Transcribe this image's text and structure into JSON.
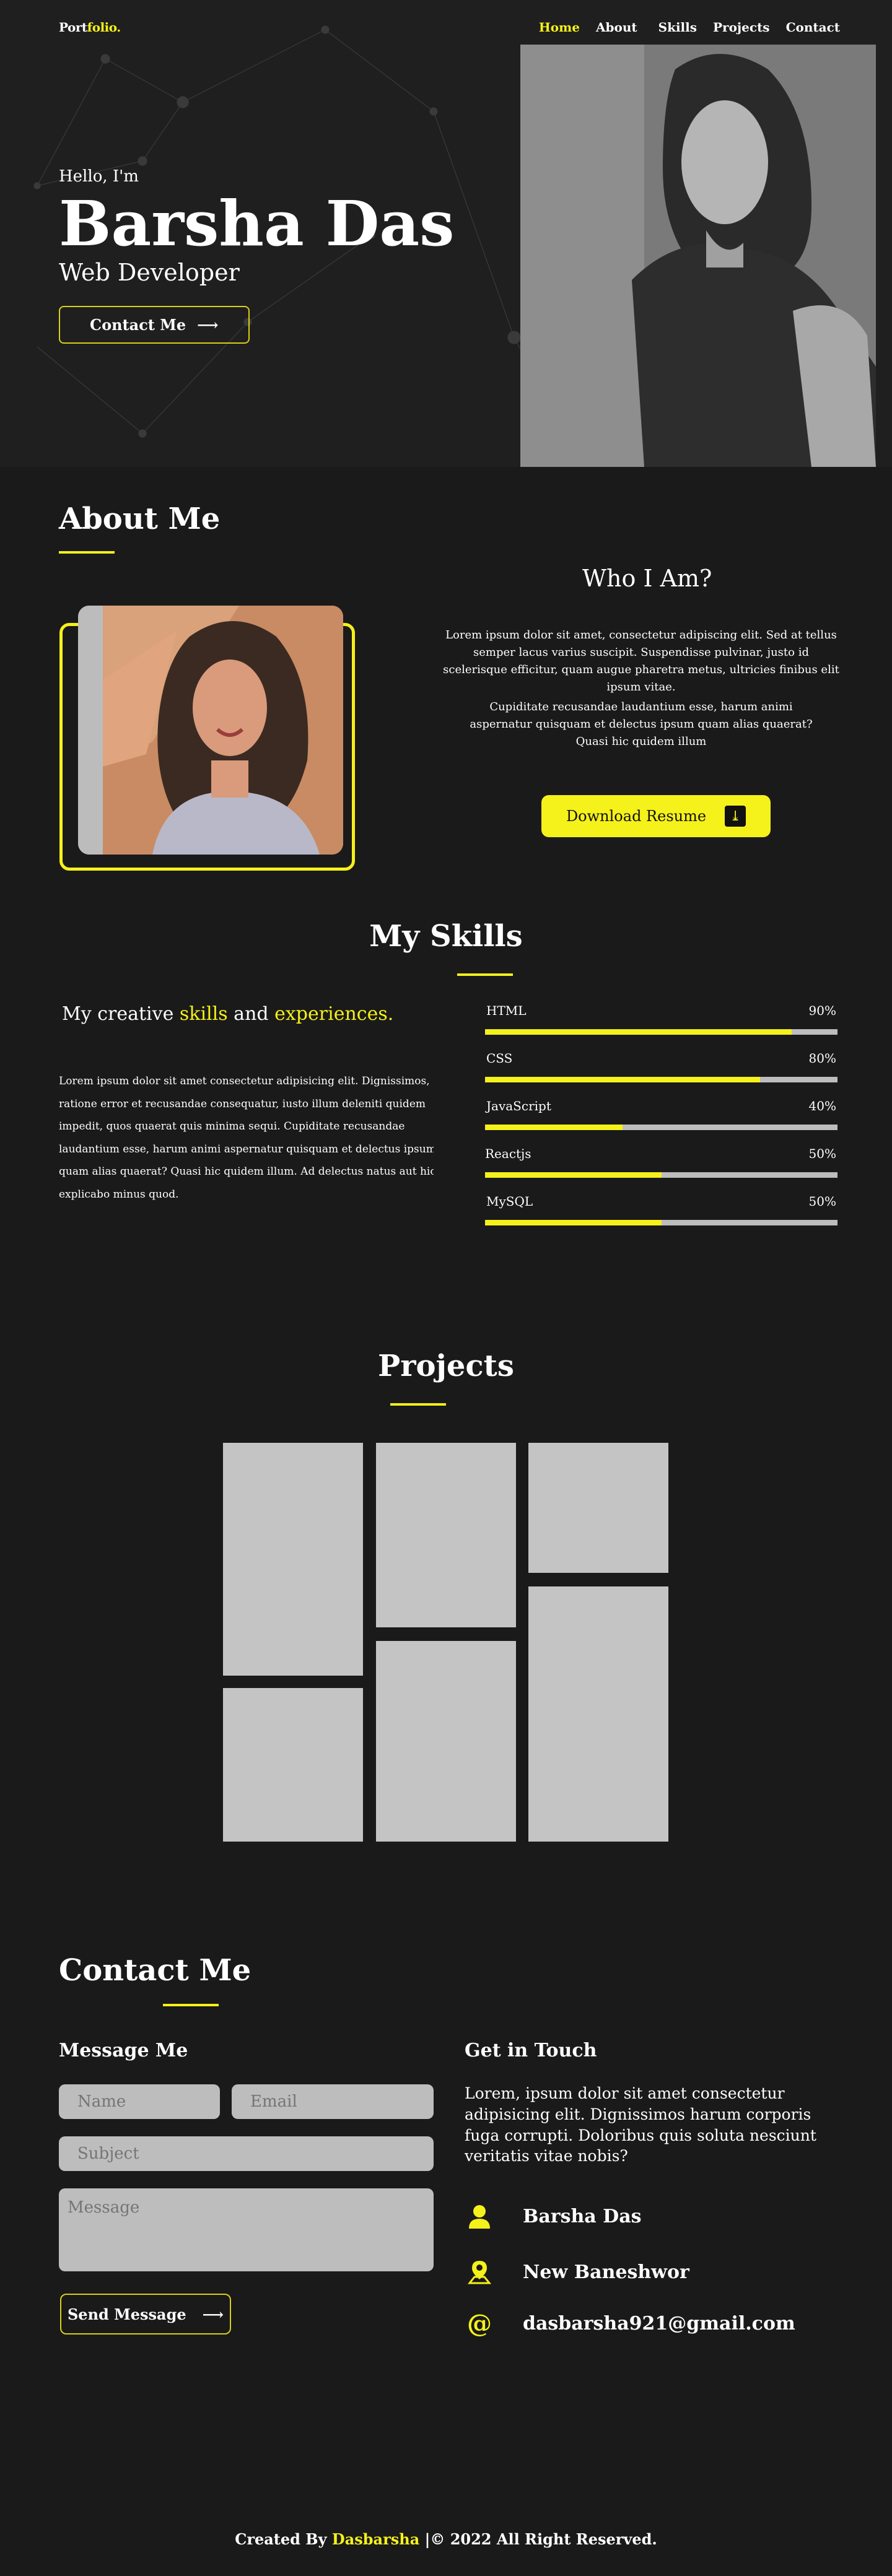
{
  "nav": {
    "logo_main": "Port",
    "logo_accent": "folio.",
    "items": [
      {
        "label": "Home",
        "active": true
      },
      {
        "label": "About",
        "active": false
      },
      {
        "label": "Skills",
        "active": false
      },
      {
        "label": "Projects",
        "active": false
      },
      {
        "label": "Contact",
        "active": false
      }
    ]
  },
  "hero": {
    "greeting": "Hello, I'm",
    "name": "Barsha Das",
    "role": "Web Developer",
    "cta_label": "Contact Me"
  },
  "about": {
    "title": "About Me",
    "subtitle": "Who I Am?",
    "paragraph_1": "Lorem ipsum dolor sit amet, consectetur adipiscing elit. Sed at tellus semper lacus varius suscipit. Suspendisse pulvinar, justo id scelerisque efficitur, quam augue pharetra metus, ultricies finibus elit ipsum vitae.",
    "paragraph_2": "Cupiditate recusandae laudantium esse, harum animi aspernatur quisquam et delectus ipsum quam alias quaerat? Quasi hic quidem illum",
    "resume_label": "Download Resume"
  },
  "skills": {
    "title": "My Skills",
    "tagline_1": "My creative ",
    "tagline_2": "skills",
    "tagline_3": " and ",
    "tagline_4": "experiences.",
    "paragraph_lines": [
      "Lorem ipsum dolor sit amet consectetur adipisicing elit. Dignissimos,",
      "ratione error et recusandae consequatur, iusto illum deleniti quidem",
      "impedit, quos quaerat quis minima sequi. Cupiditate recusandae",
      "laudantium esse, harum animi aspernatur quisquam et delectus ipsum",
      "quam alias quaerat? Quasi hic quidem illum. Ad delectus natus aut hic",
      "explicabo minus quod."
    ],
    "bars": [
      {
        "name": "HTML",
        "percent_label": "90%",
        "fill": 0.87
      },
      {
        "name": "CSS",
        "percent_label": "80%",
        "fill": 0.78
      },
      {
        "name": "JavaScript",
        "percent_label": "40%",
        "fill": 0.39
      },
      {
        "name": "Reactjs",
        "percent_label": "50%",
        "fill": 0.5
      },
      {
        "name": "MySQL",
        "percent_label": "50%",
        "fill": 0.5
      }
    ]
  },
  "projects": {
    "title": "Projects"
  },
  "contact": {
    "title": "Contact Me",
    "message_heading": "Message Me",
    "name_placeholder": "Name",
    "email_placeholder": "Email",
    "subject_placeholder": "Subject",
    "message_placeholder": "Message",
    "send_label": "Send Message",
    "touch_heading": "Get in Touch",
    "touch_paragraph": "Lorem, ipsum dolor sit amet consectetur adipisicing elit. Dignissimos harum corporis fuga corrupti. Doloribus quis soluta nesciunt veritatis vitae nobis?",
    "person": "Barsha Das",
    "location": "New Baneshwor",
    "email": "dasbarsha921@gmail.com"
  },
  "footer": {
    "prefix": "Created By ",
    "author": "Dasbarsha",
    "suffix": " |© 2022 All Right Reserved."
  },
  "colors": {
    "accent": "#f5f11a",
    "background": "#1a1a1a",
    "placeholder_tile": "#c4c4c4"
  }
}
